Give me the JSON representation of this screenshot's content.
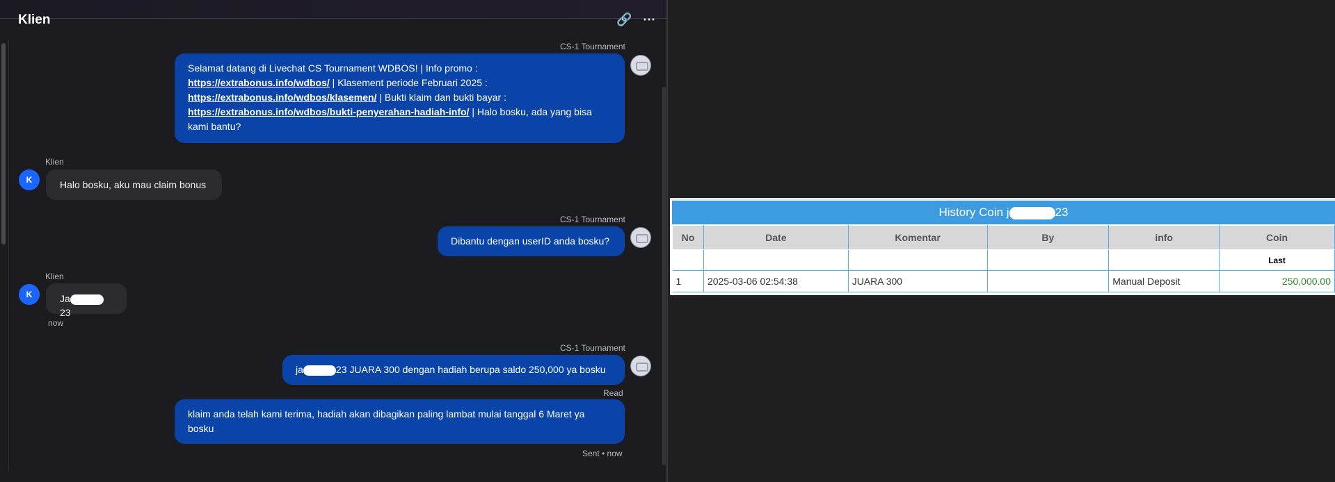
{
  "chat": {
    "title": "Klien",
    "icons": {
      "link": "link-icon",
      "more": "more-icon"
    },
    "messages": [
      {
        "sender": "CS-1 Tournament",
        "parts": [
          "Selamat datang di Livechat CS Tournament WDBOS! | Info promo :",
          "https://extrabonus.info/wdbos/",
          " | Klasement periode Februari 2025 :",
          "https://extrabonus.info/wdbos/klasemen/",
          " | Bukti klaim dan bukti bayar :",
          "https://extrabonus.info/wdbos/bukti-penyerahan-hadiah-info/",
          " | Halo bosku, ada yang bisa kami bantu?"
        ]
      },
      {
        "sender": "Klien",
        "avatar": "K",
        "text": "Halo bosku, aku mau claim bonus"
      },
      {
        "sender": "CS-1 Tournament",
        "text": "Dibantu dengan userID anda bosku?"
      },
      {
        "sender": "Klien",
        "avatar": "K",
        "text_prefix": "Ja",
        "text_suffix": "23",
        "time": "now"
      },
      {
        "sender": "CS-1 Tournament",
        "text_prefix": "ja",
        "text_suffix": "23 JUARA 300 dengan hadiah berupa saldo 250,000 ya bosku",
        "status": "Read"
      },
      {
        "text": "klaim anda telah kami terima, hadiah akan dibagikan paling lambat mulai tanggal 6 Maret ya bosku",
        "status": "Sent • now"
      }
    ]
  },
  "history": {
    "title_prefix": "History Coin j",
    "title_suffix": "23",
    "columns": [
      "No",
      "Date",
      "Komentar",
      "By",
      "info",
      "Coin"
    ],
    "last_label": "Last",
    "rows": [
      {
        "no": "1",
        "date": "2025-03-06 02:54:38",
        "komentar": "JUARA 300",
        "by": "",
        "info": "Manual Deposit",
        "coin": "250,000.00"
      }
    ]
  }
}
